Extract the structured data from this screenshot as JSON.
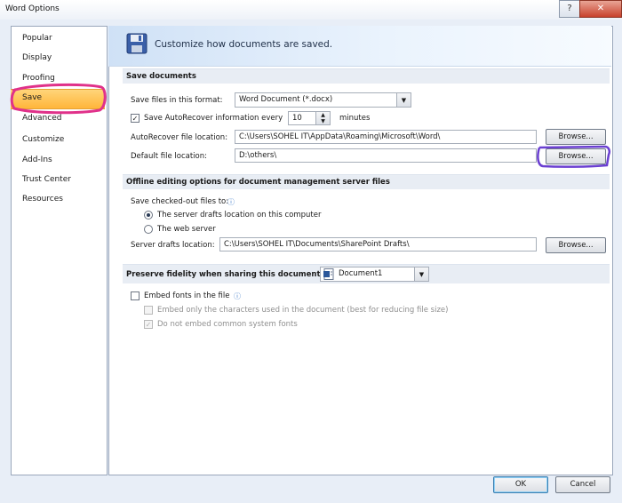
{
  "window": {
    "title": "Word Options",
    "help_glyph": "?",
    "close_glyph": "✕"
  },
  "sidebar": {
    "items": [
      {
        "label": "Popular"
      },
      {
        "label": "Display"
      },
      {
        "label": "Proofing"
      },
      {
        "label": "Save"
      },
      {
        "label": "Advanced"
      },
      {
        "label": "Customize"
      },
      {
        "label": "Add-Ins"
      },
      {
        "label": "Trust Center"
      },
      {
        "label": "Resources"
      }
    ],
    "selected": "Save"
  },
  "header": {
    "text": "Customize how documents are saved."
  },
  "save_documents": {
    "section_title": "Save documents",
    "format_label": "Save files in this format:",
    "format_value": "Word Document (*.docx)",
    "autorecover_label": "Save AutoRecover information every",
    "autorecover_checked": true,
    "autorecover_minutes": "10",
    "minutes_label": "minutes",
    "autorecover_location_label": "AutoRecover file location:",
    "autorecover_location_value": "C:\\Users\\SOHEL IT\\AppData\\Roaming\\Microsoft\\Word\\",
    "default_location_label": "Default file location:",
    "default_location_value": "D:\\others\\",
    "browse_label": "Browse..."
  },
  "offline_editing": {
    "section_title": "Offline editing options for document management server files",
    "checkout_label": "Save checked-out files to:",
    "option_server": "The server drafts location on this computer",
    "option_web": "The web server",
    "drafts_location_label": "Server drafts location:",
    "drafts_location_value": "C:\\Users\\SOHEL IT\\Documents\\SharePoint Drafts\\",
    "browse_label": "Browse..."
  },
  "fidelity": {
    "section_title": "Preserve fidelity when sharing this document:",
    "document_value": "Document1",
    "embed_fonts_label": "Embed fonts in the file",
    "embed_chars_label": "Embed only the characters used in the document (best for reducing file size)",
    "no_common_fonts_label": "Do not embed common system fonts"
  },
  "footer": {
    "ok_label": "OK",
    "cancel_label": "Cancel"
  },
  "annotations": {
    "highlight_color": "#e0318a",
    "browse_highlight_color": "#6a3fd1"
  }
}
